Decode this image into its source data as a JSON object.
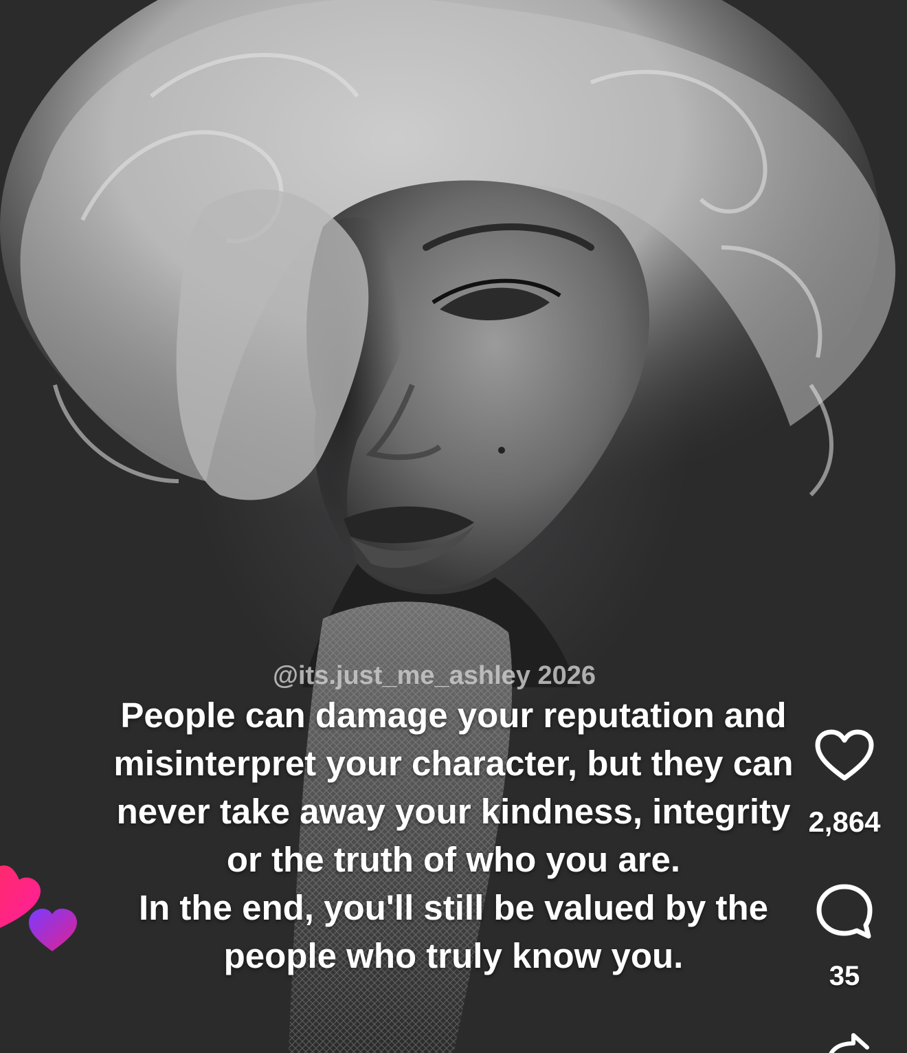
{
  "post": {
    "watermark": "@its.just_me_ashley 2026",
    "caption_lines": [
      "People can damage your reputation and",
      "misinterpret your character, but they can",
      "never take away your kindness, integrity",
      "or the truth of who you are.",
      "In the end, you'll still be valued by the",
      "people who truly know you."
    ]
  },
  "actions": {
    "like_count": "2,864",
    "comment_count": "35"
  },
  "icons": {
    "like": "heart-outline-icon",
    "comment": "speech-bubble-icon",
    "share": "share-arrow-icon",
    "floating": "floating-hearts-icon"
  },
  "colors": {
    "background": "#2b2b2c",
    "text": "#ffffff",
    "heart_pink": "#ff1f6e",
    "heart_purple": "#9b3bff"
  }
}
